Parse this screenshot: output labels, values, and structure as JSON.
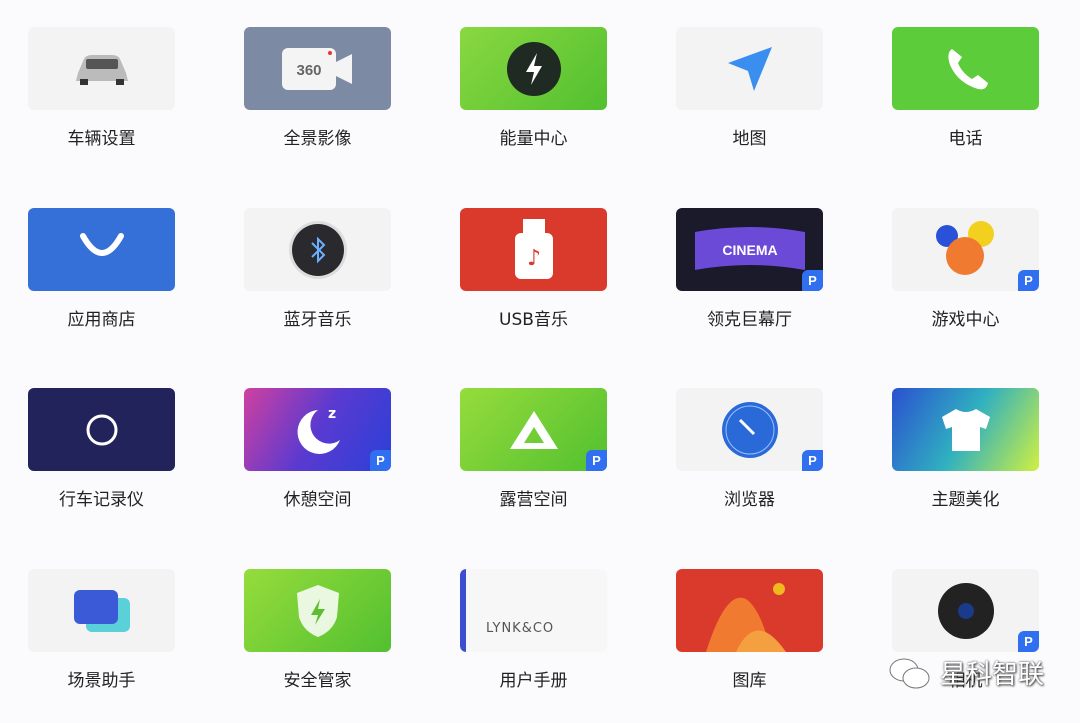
{
  "apps": [
    {
      "label": "车辆设置",
      "icon": "car-icon",
      "bg": "#f3f3f3",
      "badge": false
    },
    {
      "label": "全景影像",
      "icon": "360-camera-icon",
      "icon_text": "360",
      "bg": "#7d8aa3",
      "badge": false
    },
    {
      "label": "能量中心",
      "icon": "lightning-icon",
      "bg": "#6dcc3c",
      "badge": false
    },
    {
      "label": "地图",
      "icon": "navigation-arrow-icon",
      "bg": "#f3f3f3",
      "badge": false
    },
    {
      "label": "电话",
      "icon": "phone-icon",
      "bg": "#5ccc3a",
      "badge": false
    },
    {
      "label": "应用商店",
      "icon": "app-store-icon",
      "bg": "#3470d8",
      "badge": false
    },
    {
      "label": "蓝牙音乐",
      "icon": "bluetooth-icon",
      "bg": "#f3f3f3",
      "badge": false
    },
    {
      "label": "USB音乐",
      "icon": "usb-music-icon",
      "bg": "#d93a2c",
      "badge": false
    },
    {
      "label": "领克巨幕厅",
      "icon": "cinema-icon",
      "icon_text": "CINEMA",
      "bg": "#1a1a2a",
      "badge": true
    },
    {
      "label": "游戏中心",
      "icon": "game-icon",
      "bg": "#f3f3f3",
      "badge": true
    },
    {
      "label": "行车记录仪",
      "icon": "dashcam-icon",
      "bg": "#22235a",
      "badge": false
    },
    {
      "label": "休憩空间",
      "icon": "moon-icon",
      "icon_text": "z",
      "bg": "#5a3ad0",
      "badge": true
    },
    {
      "label": "露营空间",
      "icon": "tent-icon",
      "bg": "#6dcc3c",
      "badge": true
    },
    {
      "label": "浏览器",
      "icon": "compass-icon",
      "bg": "#f3f3f3",
      "badge": true
    },
    {
      "label": "主题美化",
      "icon": "tshirt-icon",
      "bg": "#3aa0c8",
      "badge": false
    },
    {
      "label": "场景助手",
      "icon": "scene-cards-icon",
      "bg": "#f3f3f3",
      "badge": false
    },
    {
      "label": "安全管家",
      "icon": "shield-icon",
      "bg": "#6dcc3c",
      "badge": false
    },
    {
      "label": "用户手册",
      "icon": "manual-icon",
      "icon_text": "LYNK&CO",
      "bg": "#f7f7f7",
      "badge": false
    },
    {
      "label": "图库",
      "icon": "gallery-icon",
      "bg": "#d93a2c",
      "badge": false
    },
    {
      "label": "相机",
      "icon": "camera-icon",
      "bg": "#f3f3f3",
      "badge": true
    }
  ],
  "badge_text": "P",
  "watermark": "星科智联"
}
